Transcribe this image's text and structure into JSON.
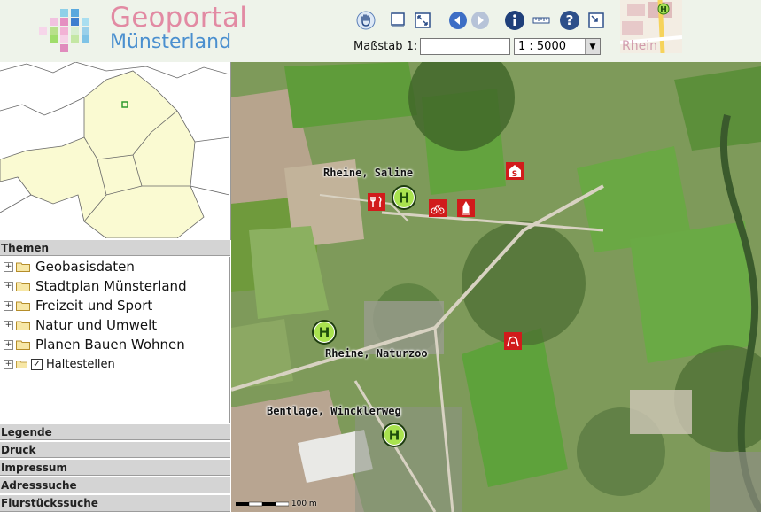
{
  "header": {
    "brand_line1": "Geoportal",
    "brand_line2": "Münsterland",
    "scale_label": "Maßstab 1:",
    "scale_input_value": "",
    "scale_select": "1 : 5000",
    "toolbar_icons": [
      "pan-hand-icon",
      "zoom-box-icon",
      "full-extent-icon",
      "back-arrow-icon",
      "forward-arrow-icon",
      "info-icon",
      "measure-icon",
      "help-icon",
      "zoom-select-icon"
    ]
  },
  "minimap": {
    "label": "Rhein",
    "stop_letter": "H"
  },
  "sidebar": {
    "themen_header": "Themen",
    "tree": [
      {
        "label": "Geobasisdaten",
        "checkbox": false
      },
      {
        "label": "Stadtplan Münsterland",
        "checkbox": false
      },
      {
        "label": "Freizeit und Sport",
        "checkbox": false
      },
      {
        "label": "Natur und Umwelt",
        "checkbox": false
      },
      {
        "label": "Planen Bauen Wohnen",
        "checkbox": false
      },
      {
        "label": "Haltestellen",
        "checkbox": true,
        "check_mark": "✓"
      }
    ],
    "panels": [
      "Legende",
      "Druck",
      "Impressum",
      "Adresssuche",
      "Flurstückssuche"
    ]
  },
  "map": {
    "labels": {
      "saline": "Rheine, Saline",
      "naturzoo": "Rheine, Naturzoo",
      "wincklerweg": "Bentlage, Wincklerweg"
    },
    "stop_letter": "H",
    "scale_text": "100 m"
  },
  "colors": {
    "accent_pink": "#e28aa3",
    "accent_blue": "#4a8fcf",
    "stop_green": "#7ed321",
    "poi_red": "#d11b1b"
  }
}
